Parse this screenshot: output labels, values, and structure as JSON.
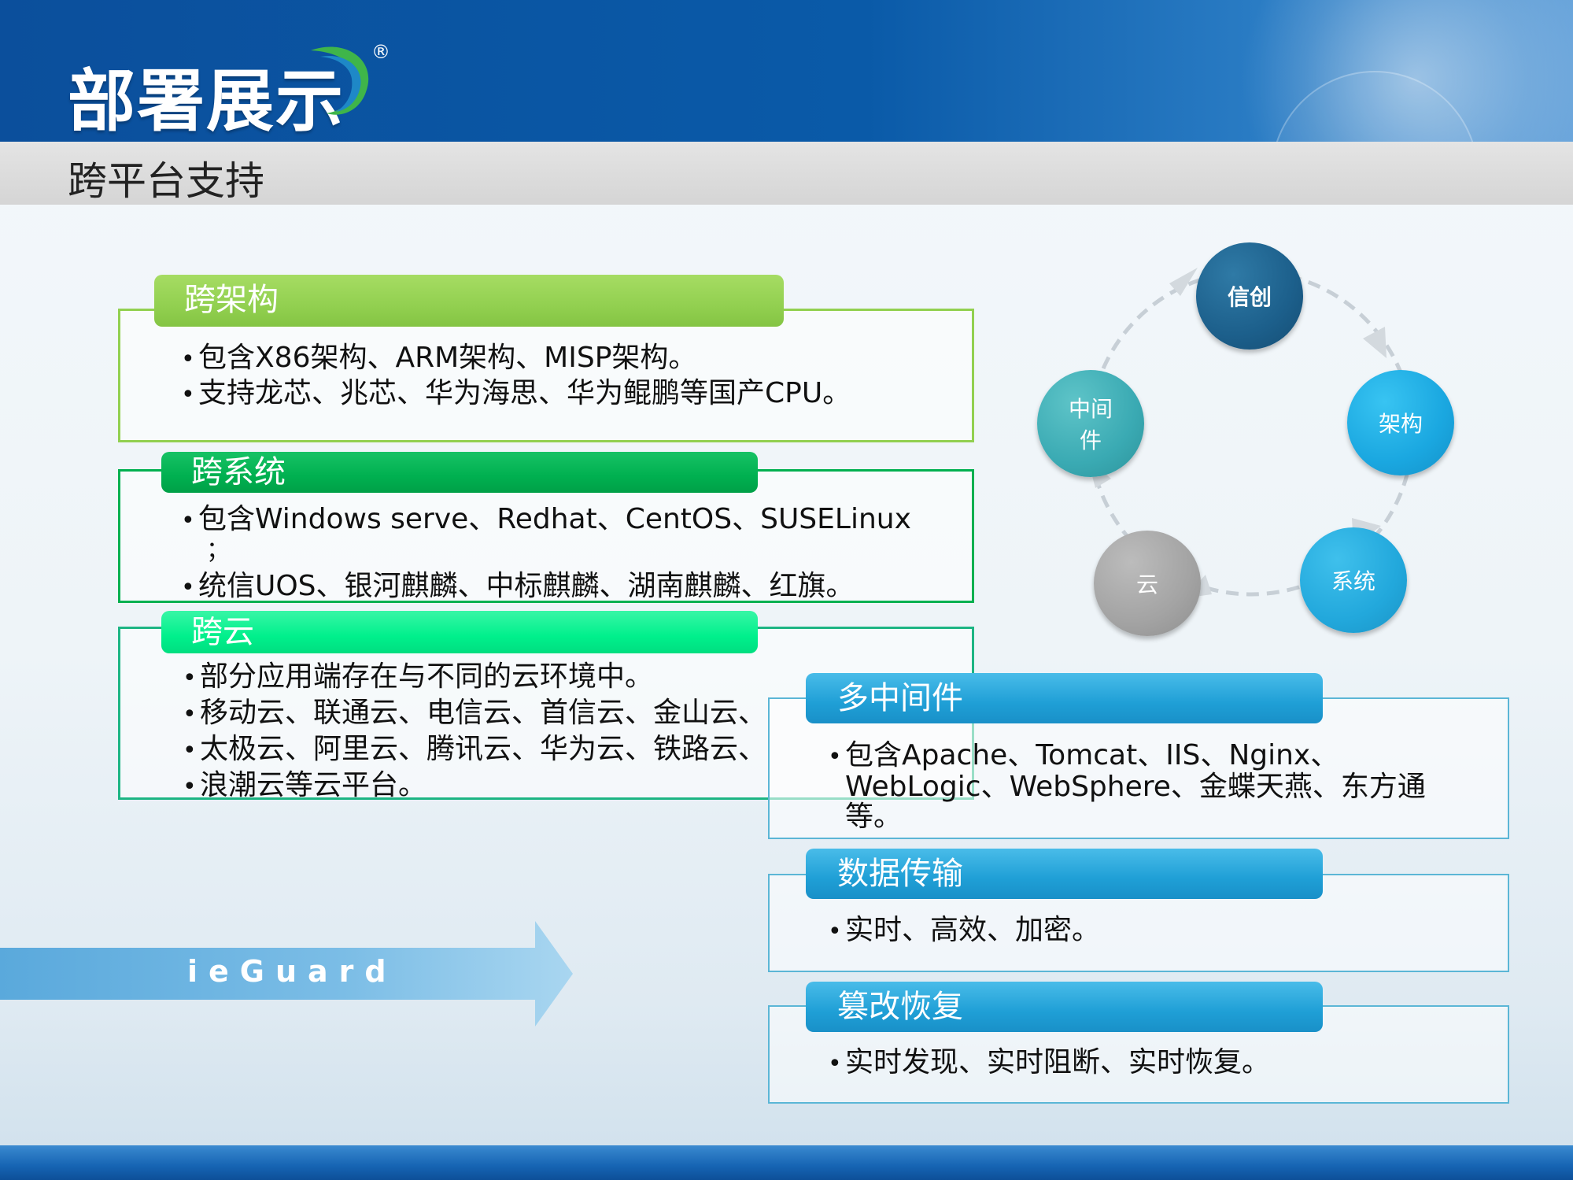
{
  "header": {
    "title": "部署展示",
    "registered_mark": "®",
    "subtitle": "跨平台支持"
  },
  "left_sections": [
    {
      "tab": "跨架构",
      "bullets": [
        "包含X86架构、ARM架构、MISP架构。",
        "支持龙芯、兆芯、华为海思、华为鲲鹏等国产CPU。"
      ]
    },
    {
      "tab": "跨系统",
      "bullets": [
        "包含Windows serve、Redhat、CentOS、SUSELinux",
        "；",
        "统信UOS、银河麒麟、中标麒麟、湖南麒麟、红旗。"
      ]
    },
    {
      "tab": "跨云",
      "bullets": [
        "部分应用端存在与不同的云环境中。",
        "移动云、联通云、电信云、首信云、金山云、",
        "太极云、阿里云、腾讯云、华为云、铁路云、",
        "浪潮云等云平台。"
      ]
    }
  ],
  "right_sections": [
    {
      "tab": "多中间件",
      "lines": [
        "包含Apache、Tomcat、IIS、Nginx、",
        "WebLogic、WebSphere、金蝶天燕、东方通",
        "等。"
      ]
    },
    {
      "tab": "数据传输",
      "lines": [
        "实时、高效、加密。"
      ]
    },
    {
      "tab": "篡改恢复",
      "lines": [
        "实时发现、实时阻断、实时恢复。"
      ]
    }
  ],
  "cycle": {
    "nodes": [
      "信创",
      "架构",
      "系统",
      "云",
      "中间\n件"
    ]
  },
  "arrow": {
    "label": "ieGuard"
  },
  "colors": {
    "header_blue": "#0b4f9c",
    "arch_green": "#92d050",
    "sys_green": "#00b050",
    "cloud_green": "#00f08c",
    "right_blue": "#1f9fd6"
  }
}
